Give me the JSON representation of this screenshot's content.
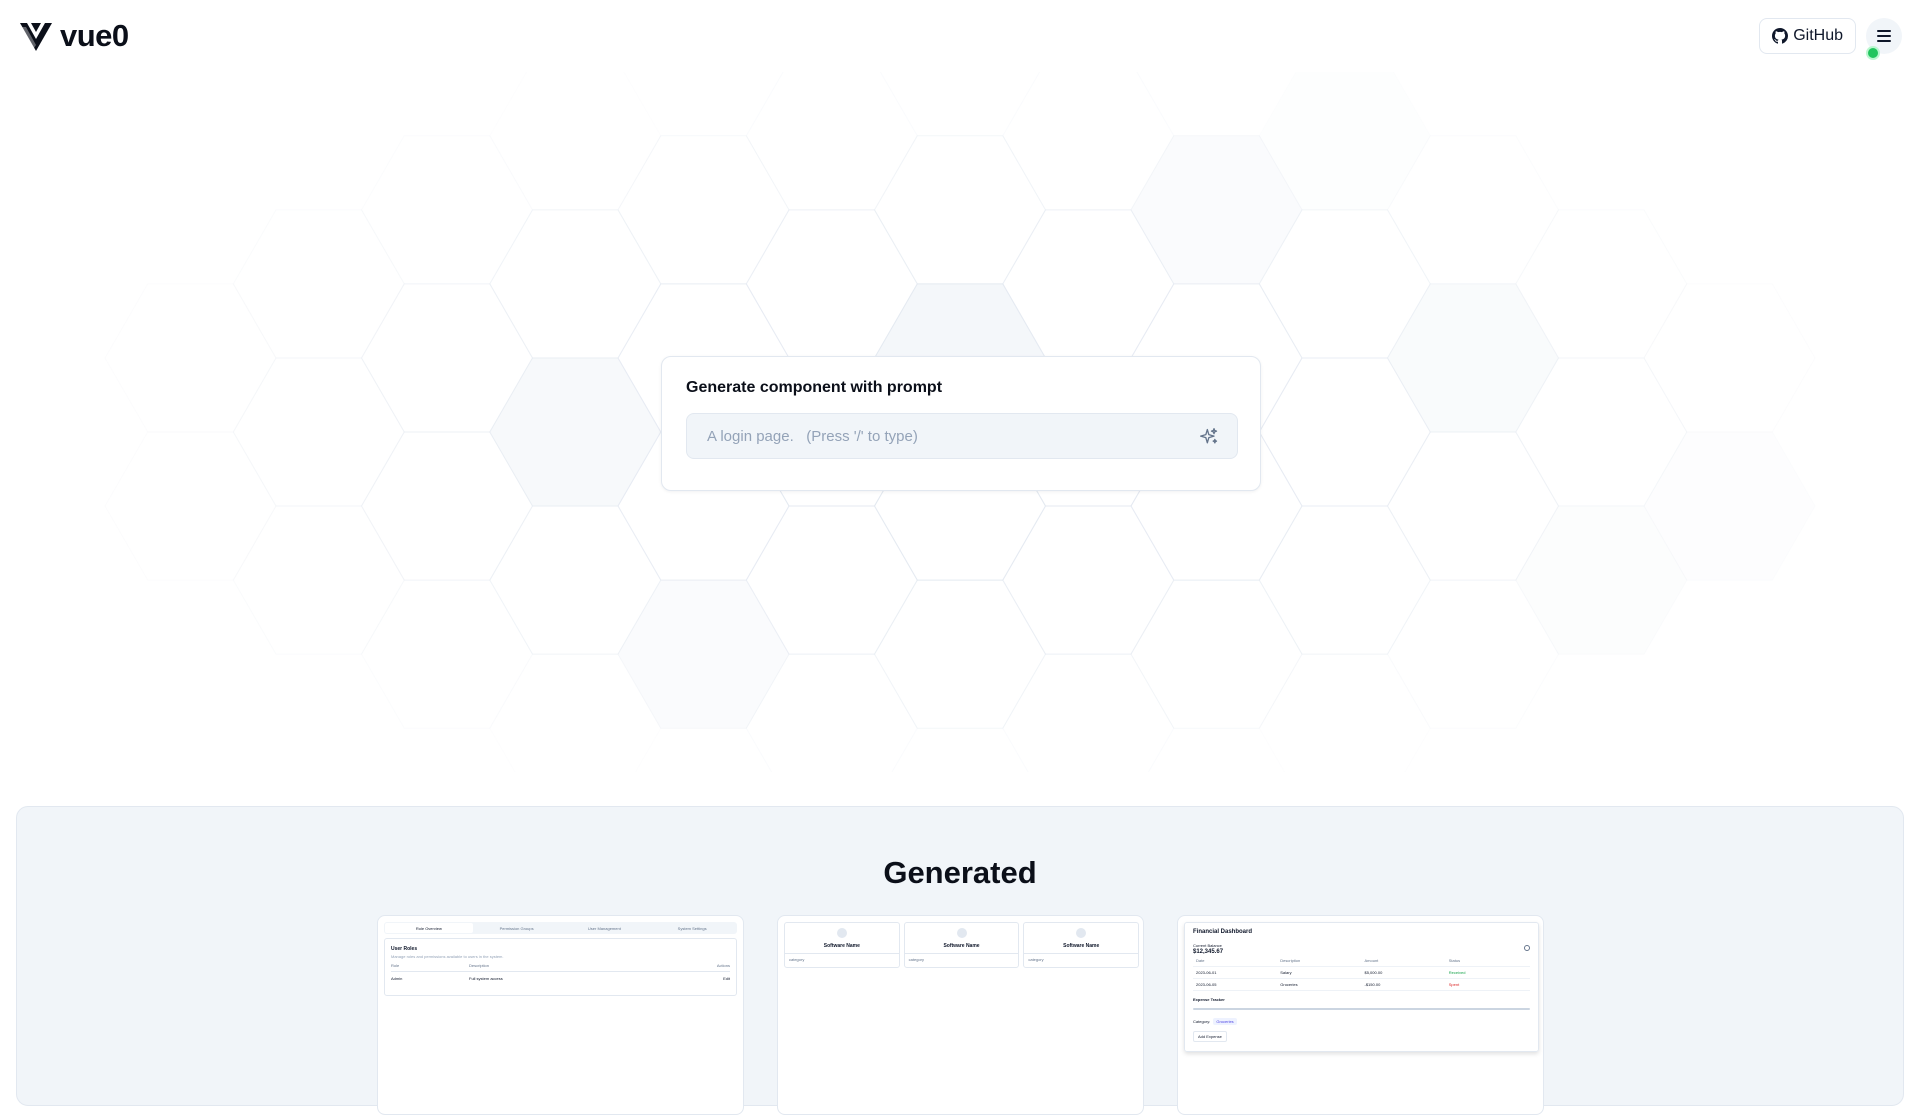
{
  "header": {
    "brand_name": "vue0",
    "github_label": "GitHub"
  },
  "prompt": {
    "title": "Generate component with prompt",
    "placeholder": "A login page.   (Press '/' to type)",
    "value": ""
  },
  "generated": {
    "title": "Generated",
    "thumb1": {
      "tabs": [
        "Role Overview",
        "Permission Groups",
        "User Management",
        "System Settings"
      ],
      "card_title": "User Roles",
      "card_subtitle": "Manage roles and permissions available to users in the system.",
      "columns": [
        "Role",
        "Description",
        "Actions"
      ],
      "rows": [
        [
          "Admin",
          "Full system access",
          "Edit"
        ]
      ]
    },
    "thumb2": {
      "cards": [
        {
          "name": "Software Name",
          "category": "category"
        },
        {
          "name": "Software Name",
          "category": "category"
        },
        {
          "name": "Software Name",
          "category": "category"
        }
      ]
    },
    "thumb3": {
      "title": "Financial Dashboard",
      "balance_label": "Current Balance",
      "balance": "$12,345.67",
      "columns": [
        "Date",
        "Description",
        "Amount",
        "Status"
      ],
      "rows": [
        [
          "2023-06-01",
          "Salary",
          "$5,000.00",
          "Received"
        ],
        [
          "2023-06-05",
          "Groceries",
          "-$150.00",
          "Spent"
        ]
      ],
      "section": "Expense Tracker",
      "badge_label": "Category:",
      "badge": "Groceries",
      "button": "Add Expense"
    }
  },
  "colors": {
    "status_dot": "#22c55e",
    "section_bg": "#f1f5f9"
  }
}
